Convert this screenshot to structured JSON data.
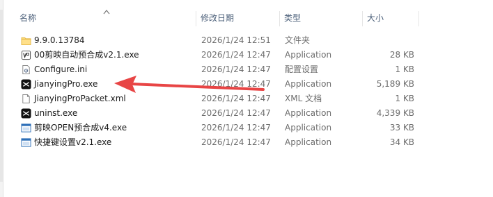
{
  "columns": {
    "name": "名称",
    "date": "修改日期",
    "type": "类型",
    "size": "大小"
  },
  "files": [
    {
      "name": "9.9.0.13784",
      "date": "2026/1/24 12:51",
      "type": "文件夹",
      "size": "",
      "icon": "folder-icon"
    },
    {
      "name": "00剪映自动预合成v2.1.exe",
      "date": "2026/1/24 12:47",
      "type": "Application",
      "size": "28 KB",
      "icon": "app-icon"
    },
    {
      "name": "Configure.ini",
      "date": "2026/1/24 12:47",
      "type": "配置设置",
      "size": "1 KB",
      "icon": "settings-file-icon"
    },
    {
      "name": "JianyingPro.exe",
      "date": "2026/1/24 12:47",
      "type": "Application",
      "size": "5,189 KB",
      "icon": "capcut-icon"
    },
    {
      "name": "JianyingProPacket.xml",
      "date": "2026/1/24 12:47",
      "type": "XML 文档",
      "size": "1 KB",
      "icon": "document-icon"
    },
    {
      "name": "uninst.exe",
      "date": "2026/1/24 12:47",
      "type": "Application",
      "size": "4,339 KB",
      "icon": "capcut-icon"
    },
    {
      "name": "剪映OPEN预合成v4.exe",
      "date": "2026/1/24 12:47",
      "type": "Application",
      "size": "33 KB",
      "icon": "window-app-icon"
    },
    {
      "name": "快捷键设置v2.1.exe",
      "date": "2026/1/24 12:47",
      "type": "Application",
      "size": "34 KB",
      "icon": "window-app-icon"
    }
  ],
  "annotation": {
    "arrow_color": "#e84545"
  }
}
